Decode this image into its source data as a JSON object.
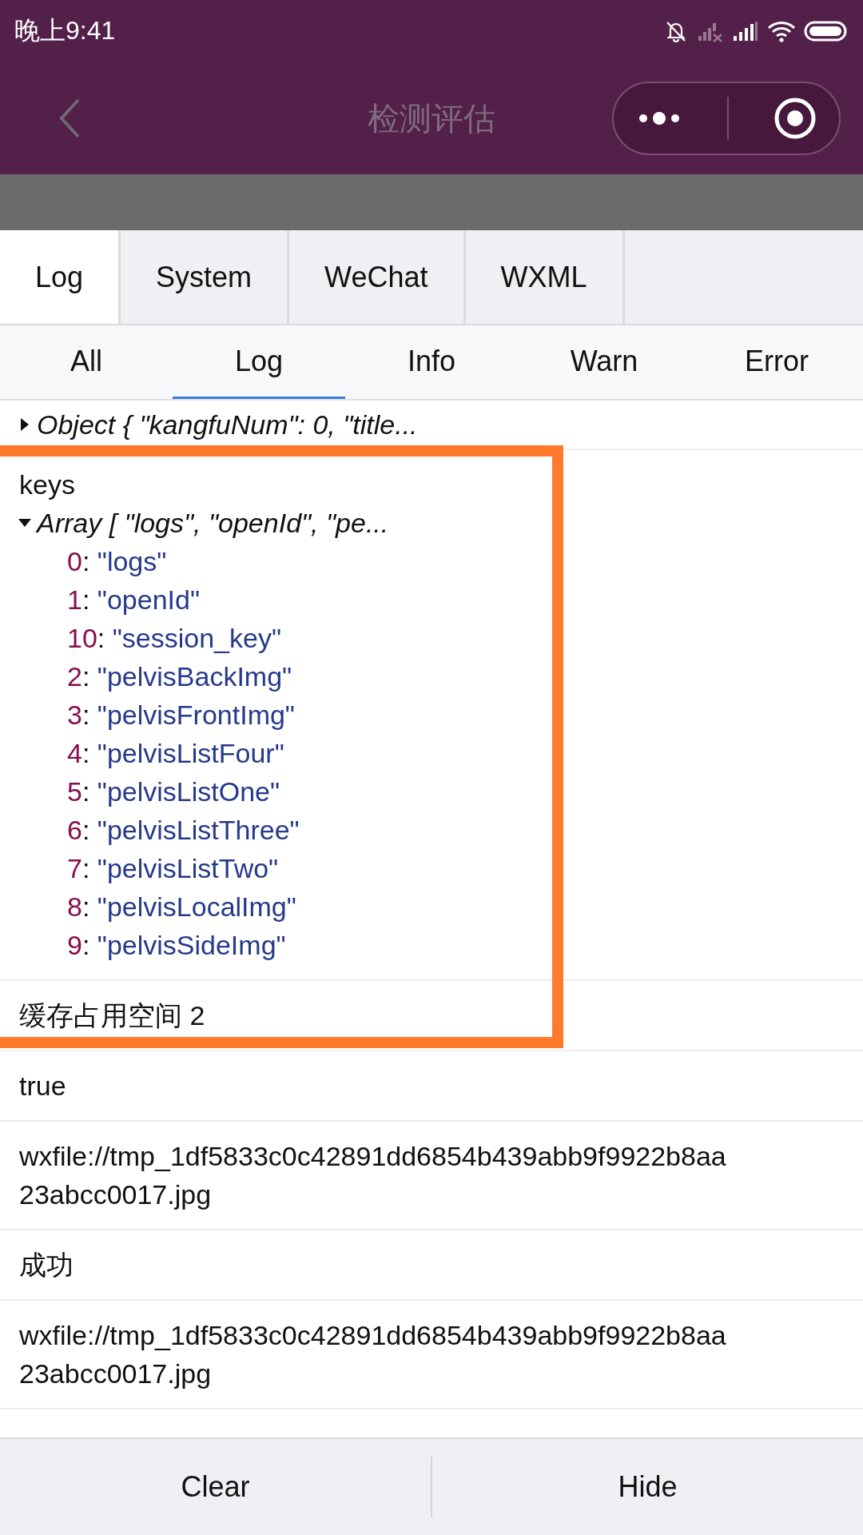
{
  "status_bar": {
    "time": "晚上9:41"
  },
  "nav": {
    "title": "检测评估"
  },
  "tabs": [
    {
      "label": "Log",
      "selected": true
    },
    {
      "label": "System",
      "selected": false
    },
    {
      "label": "WeChat",
      "selected": false
    },
    {
      "label": "WXML",
      "selected": false
    }
  ],
  "filters": [
    {
      "label": "All",
      "selected": false
    },
    {
      "label": "Log",
      "selected": true
    },
    {
      "label": "Info",
      "selected": false
    },
    {
      "label": "Warn",
      "selected": false
    },
    {
      "label": "Error",
      "selected": false
    }
  ],
  "logs": [
    {
      "kind": "object",
      "summary": "Object { \"kangfuNum\": 0, \"title...",
      "expanded": false,
      "highlighted": false
    },
    {
      "kind": "array",
      "label": "keys",
      "summary": "Array [ \"logs\", \"openId\", \"pe...",
      "expanded": true,
      "highlighted": true,
      "items": [
        {
          "index": "0",
          "sep": ":",
          "value": "\"logs\""
        },
        {
          "index": "1",
          "sep": ":",
          "value": "\"openId\""
        },
        {
          "index": "10",
          "sep": ":",
          "value": "\"session_key\""
        },
        {
          "index": "2",
          "sep": ":",
          "value": "\"pelvisBackImg\""
        },
        {
          "index": "3",
          "sep": ":",
          "value": "\"pelvisFrontImg\""
        },
        {
          "index": "4",
          "sep": ":",
          "value": "\"pelvisListFour\""
        },
        {
          "index": "5",
          "sep": ":",
          "value": "\"pelvisListOne\""
        },
        {
          "index": "6",
          "sep": ":",
          "value": "\"pelvisListThree\""
        },
        {
          "index": "7",
          "sep": ":",
          "value": "\"pelvisListTwo\""
        },
        {
          "index": "8",
          "sep": ":",
          "value": "\"pelvisLocalImg\""
        },
        {
          "index": "9",
          "sep": ":",
          "value": "\"pelvisSideImg\""
        }
      ]
    },
    {
      "kind": "text",
      "text": "缓存占用空间 2",
      "highlighted": true
    },
    {
      "kind": "text",
      "text": "true",
      "highlighted": false
    },
    {
      "kind": "text",
      "text": "wxfile://tmp_1df5833c0c42891dd6854b439abb9f9922b8aa23abcc0017.jpg",
      "highlighted": false
    },
    {
      "kind": "text",
      "text": "成功",
      "highlighted": false
    },
    {
      "kind": "text",
      "text": "wxfile://tmp_1df5833c0c42891dd6854b439abb9f9922b8aa23abcc0017.jpg",
      "highlighted": false
    }
  ],
  "buttons": [
    "Clear",
    "Hide"
  ]
}
